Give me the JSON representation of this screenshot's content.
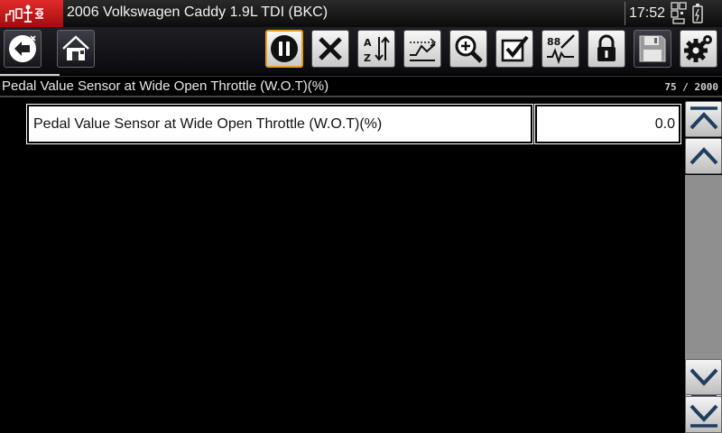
{
  "title_bar": {
    "vehicle": "2006 Volkswagen Caddy 1.9L TDI (BKC)",
    "time": "17:52",
    "logo_icon": "scanner-logo-icon",
    "status_icons": [
      "qr-code-icon",
      "battery-icon"
    ]
  },
  "toolbar": {
    "buttons": [
      {
        "id": "back",
        "icon": "back-arrow-icon"
      },
      {
        "id": "home",
        "icon": "home-icon"
      },
      {
        "id": "pause",
        "icon": "pause-icon",
        "active": true
      },
      {
        "id": "clear",
        "icon": "close-x-icon"
      },
      {
        "id": "sort",
        "icon": "sort-az-icon"
      },
      {
        "id": "graph",
        "icon": "graph-view-icon"
      },
      {
        "id": "zoom",
        "icon": "zoom-in-icon"
      },
      {
        "id": "select",
        "icon": "checkbox-icon"
      },
      {
        "id": "units",
        "icon": "units-toggle-icon"
      },
      {
        "id": "lock",
        "icon": "lock-icon"
      },
      {
        "id": "save",
        "icon": "save-disk-icon"
      },
      {
        "id": "settings",
        "icon": "settings-gear-icon"
      }
    ]
  },
  "header": {
    "pid_name": "Pedal Value Sensor at Wide Open Throttle (W.O.T)(%)",
    "count": "75 / 2000"
  },
  "table": {
    "rows": [
      {
        "name": "Pedal Value Sensor at Wide Open Throttle (W.O.T)(%)",
        "value": "0.0"
      }
    ]
  },
  "scrollbar": {
    "icons": [
      "scroll-top-icon",
      "scroll-up-icon",
      "scroll-thumb-grip-icon",
      "scroll-down-icon",
      "scroll-bottom-icon"
    ],
    "position": 0.55
  },
  "colors": {
    "accent_active": "#e3a21a",
    "logo_red": "#d01818",
    "background": "#000000"
  }
}
